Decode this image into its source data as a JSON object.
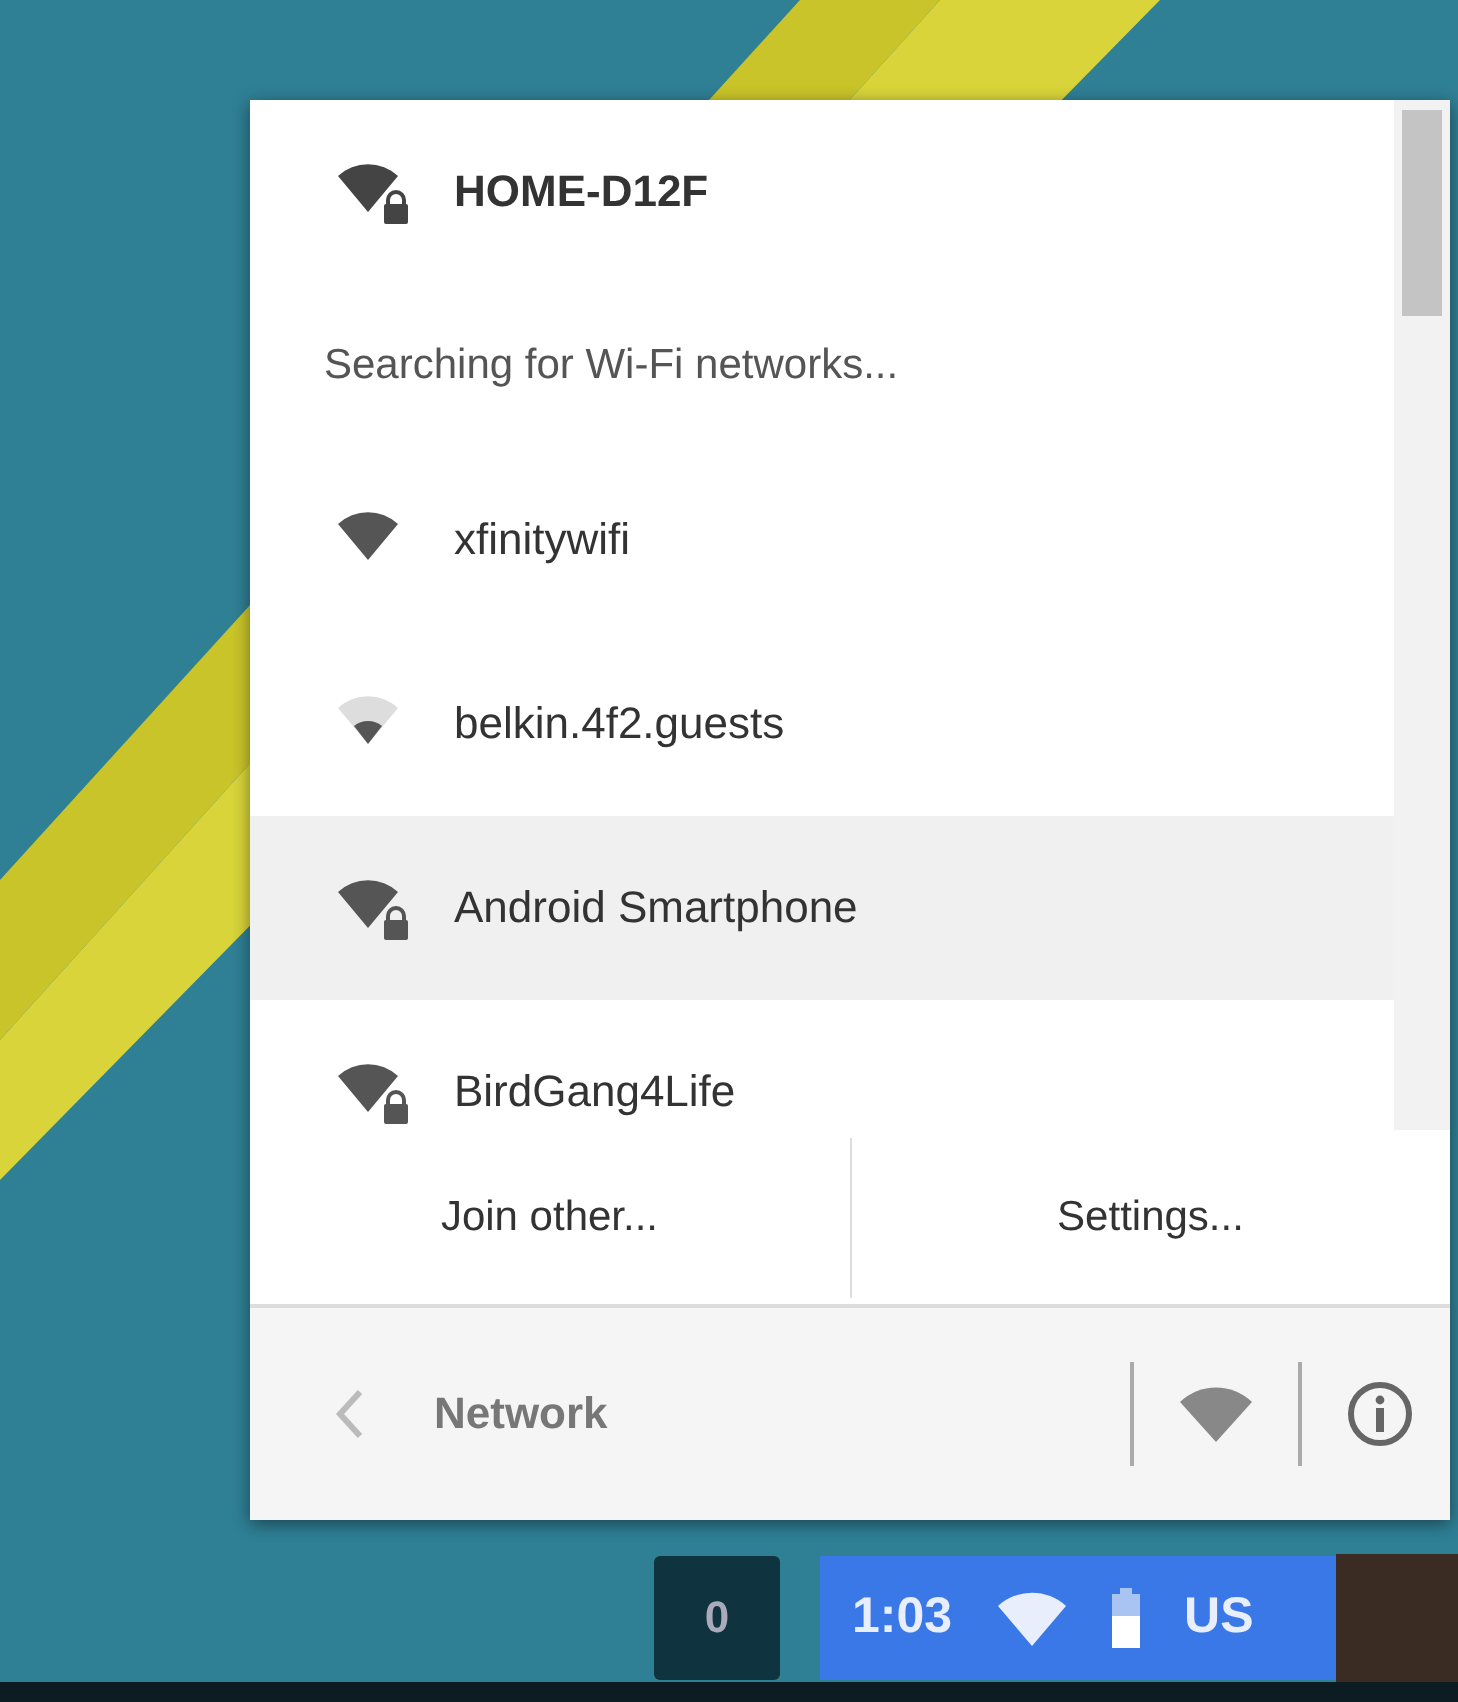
{
  "current_network": {
    "name": "HOME-D12F",
    "locked": true
  },
  "status_text": "Searching for Wi-Fi networks...",
  "networks": [
    {
      "name": "xfinitywifi",
      "kind": "strong",
      "locked": false,
      "selected": false
    },
    {
      "name": "belkin.4f2.guests",
      "kind": "weak",
      "locked": false,
      "selected": false
    },
    {
      "name": "Android Smartphone",
      "kind": "strong",
      "locked": true,
      "selected": true
    },
    {
      "name": "BirdGang4Life",
      "kind": "strong",
      "locked": true,
      "selected": false
    }
  ],
  "actions": [
    "Join other...",
    "Settings..."
  ],
  "footer": {
    "title": "Network"
  },
  "shelf": {
    "notification_count": "0",
    "time": "1:03",
    "keyboard": "US"
  }
}
